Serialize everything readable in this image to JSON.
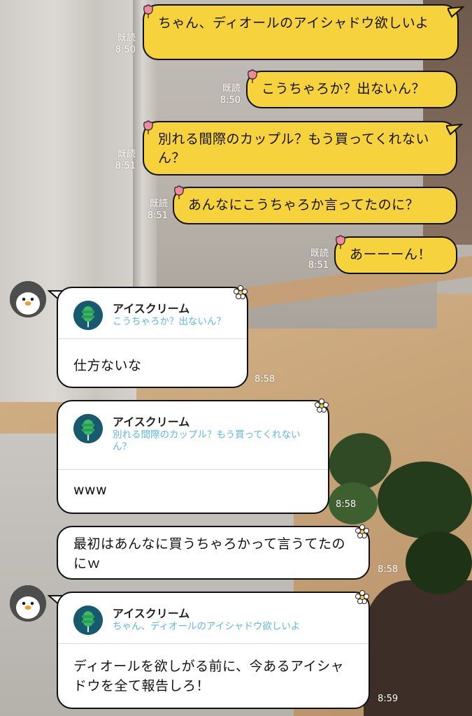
{
  "read_label": "既読",
  "sent": [
    {
      "text": "ちゃん、ディオールのアイシャドウ欲しいよ",
      "time": "8:50"
    },
    {
      "text": "こうちゃろか？出ないん？",
      "time": "8:50"
    },
    {
      "text": "別れる間際のカップル？もう買ってくれないん？",
      "time": "8:51"
    },
    {
      "text": "あんなにこうちゃろか言ってたのに？",
      "time": "8:51"
    },
    {
      "text": "あーーーん！",
      "time": "8:51"
    }
  ],
  "received": [
    {
      "quote_name": "アイスクリーム",
      "quote_text": "こうちゃろか？出ないん？",
      "text": "仕方ないな",
      "time": "8:58"
    },
    {
      "quote_name": "アイスクリーム",
      "quote_text": "別れる間際のカップル？もう買ってくれないん？",
      "text": "www",
      "time": "8:58"
    },
    {
      "text": "最初はあんなに買うちゃろかって言うてたのにｗ",
      "time": "8:58"
    },
    {
      "quote_name": "アイスクリーム",
      "quote_text": "ちゃん、ディオールのアイシャドウ欲しいよ",
      "text": "ディオールを欲しがる前に、今あるアイシャドウを全て報告しろ！",
      "time": "8:59"
    }
  ],
  "icons": {
    "avatar": "penguin-icon",
    "quote_avatar": "tree-icon",
    "sent_deco": "tulip-icon",
    "received_deco": "flower-icon"
  },
  "colors": {
    "sent_bubble": "#f6d23c",
    "received_bubble": "#ffffff",
    "quote_name": "#222222",
    "quote_text": "#5cb8e6"
  }
}
